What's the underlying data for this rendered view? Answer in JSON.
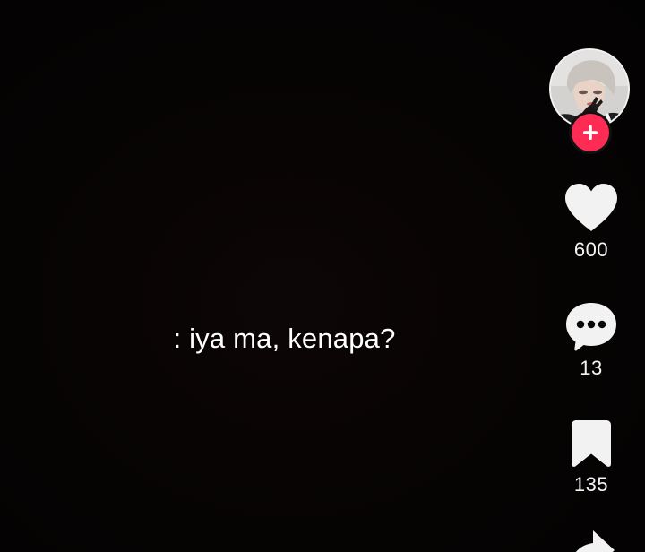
{
  "caption": {
    "text": ": iya ma, kenapa?"
  },
  "sidebar": {
    "avatar": {
      "icon": "profile-avatar",
      "follow_icon": "plus-icon",
      "follow_color": "#fe2c55"
    },
    "like": {
      "icon": "heart-icon",
      "count": "600"
    },
    "comment": {
      "icon": "comment-icon",
      "count": "13"
    },
    "save": {
      "icon": "bookmark-icon",
      "count": "135"
    },
    "share": {
      "icon": "share-arrow-icon"
    }
  },
  "colors": {
    "background": "#050303",
    "accent": "#fe2c55",
    "icon": "#f2f2f2"
  }
}
